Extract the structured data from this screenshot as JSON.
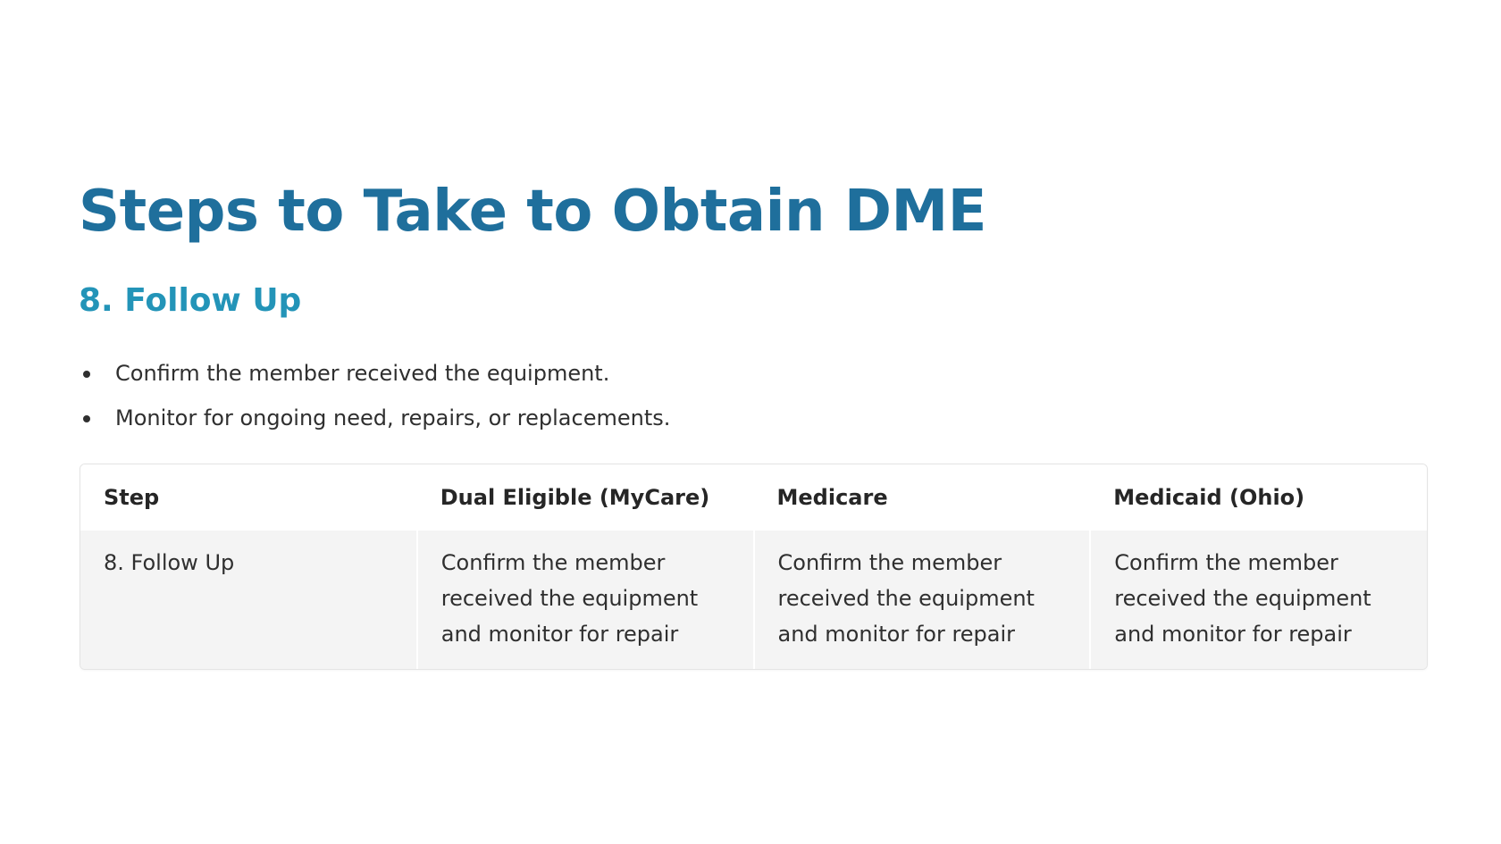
{
  "title": "Steps to Take to Obtain DME",
  "subtitle": "8. Follow Up",
  "bullets": [
    "Confirm the member received the equipment.",
    "Monitor for ongoing need, repairs, or replacements."
  ],
  "table": {
    "headers": [
      "Step",
      "Dual Eligible (MyCare)",
      "Medicare",
      "Medicaid (Ohio)"
    ],
    "rows": [
      [
        "8. Follow Up",
        "Confirm the member received the equipment and monitor for repair",
        "Confirm the member received the equipment and monitor for repair",
        "Confirm the member received the equipment and monitor for repair"
      ]
    ]
  },
  "colors": {
    "title": "#1f6f9c",
    "subtitle": "#2394b8",
    "body_text": "#2f2f2f",
    "row_background": "#f4f4f4"
  }
}
